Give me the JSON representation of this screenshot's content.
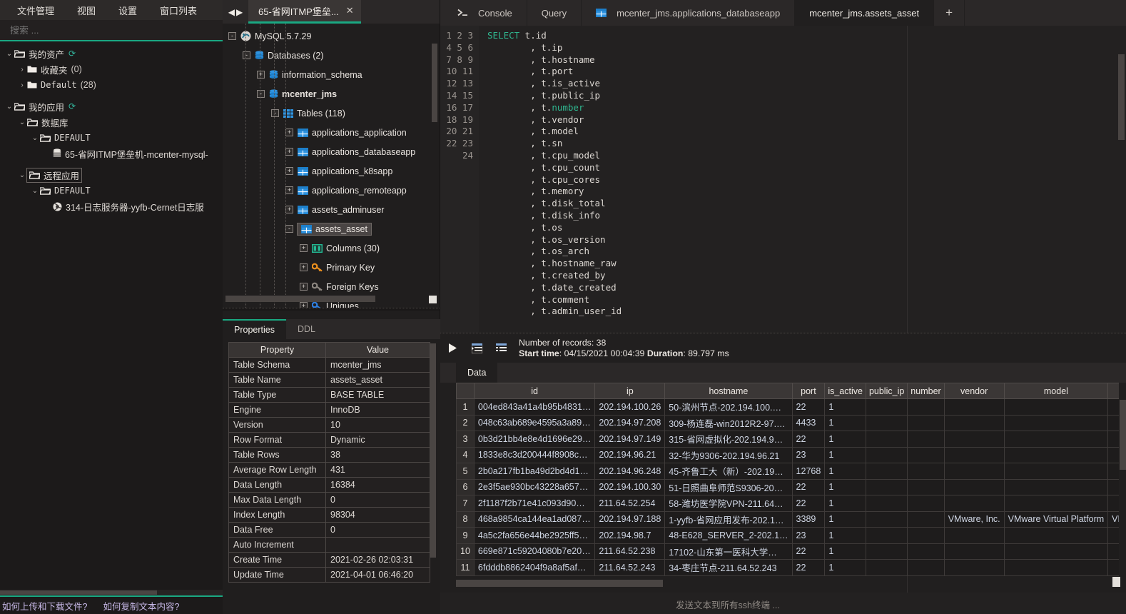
{
  "menubar": {
    "items": [
      "文件管理",
      "视图",
      "设置",
      "窗口列表"
    ]
  },
  "search": {
    "placeholder": "搜索 ..."
  },
  "asset_tree": {
    "items": [
      {
        "label": "我的资产",
        "indent": 0,
        "twisty": "down",
        "icon": "folder-open-icon",
        "count": "",
        "refresh": true,
        "mono": false,
        "selected": false
      },
      {
        "label": "收藏夹",
        "indent": 1,
        "twisty": "right",
        "icon": "folder-icon",
        "count": "(0)",
        "refresh": false,
        "mono": false,
        "selected": false
      },
      {
        "label": "Default",
        "indent": 1,
        "twisty": "right",
        "icon": "folder-icon",
        "count": "(28)",
        "refresh": false,
        "mono": true,
        "selected": false
      },
      {
        "label": "我的应用",
        "indent": 0,
        "twisty": "down",
        "icon": "folder-open-icon",
        "count": "",
        "refresh": true,
        "mono": false,
        "selected": false
      },
      {
        "label": "数据库",
        "indent": 1,
        "twisty": "down",
        "icon": "folder-open-icon",
        "count": "",
        "refresh": false,
        "mono": false,
        "selected": false
      },
      {
        "label": "DEFAULT",
        "indent": 2,
        "twisty": "down",
        "icon": "folder-open-icon",
        "count": "",
        "refresh": false,
        "mono": true,
        "selected": false
      },
      {
        "label": "65-省网ITMP堡垒机-mcenter-mysql-",
        "indent": 3,
        "twisty": "none",
        "icon": "database-icon",
        "count": "",
        "refresh": false,
        "mono": false,
        "selected": false
      },
      {
        "label": "远程应用",
        "indent": 1,
        "twisty": "down",
        "icon": "folder-open-icon",
        "count": "",
        "refresh": false,
        "mono": false,
        "selected": true
      },
      {
        "label": "DEFAULT",
        "indent": 2,
        "twisty": "down",
        "icon": "folder-open-icon",
        "count": "",
        "refresh": false,
        "mono": true,
        "selected": false
      },
      {
        "label": "314-日志服务器-yyfb-Cernet日志服",
        "indent": 3,
        "twisty": "none",
        "icon": "globe-icon",
        "count": "",
        "refresh": false,
        "mono": false,
        "selected": false
      }
    ]
  },
  "left_footer": {
    "links": [
      "如何上传和下载文件?",
      "如何复制文本内容?"
    ]
  },
  "session_tab": {
    "title": "65-省网ITMP堡垒...",
    "close": "✕"
  },
  "db_tree": {
    "items": [
      {
        "label": "MySQL 5.7.29",
        "indent": 0,
        "expander": "-",
        "icon": "mysql-icon",
        "bold": false,
        "selected": false
      },
      {
        "label": "Databases (2)",
        "indent": 1,
        "expander": "-",
        "icon": "db-stack-icon",
        "bold": false,
        "selected": false
      },
      {
        "label": "information_schema",
        "indent": 2,
        "expander": "+",
        "icon": "db-stack-icon",
        "bold": false,
        "selected": false
      },
      {
        "label": "mcenter_jms",
        "indent": 2,
        "expander": "-",
        "icon": "db-stack-icon",
        "bold": true,
        "selected": false
      },
      {
        "label": "Tables (118)",
        "indent": 3,
        "expander": "-",
        "icon": "tables-icon",
        "bold": false,
        "selected": false
      },
      {
        "label": "applications_application",
        "indent": 4,
        "expander": "+",
        "icon": "table-icon",
        "bold": false,
        "selected": false
      },
      {
        "label": "applications_databaseapp",
        "indent": 4,
        "expander": "+",
        "icon": "table-icon",
        "bold": false,
        "selected": false
      },
      {
        "label": "applications_k8sapp",
        "indent": 4,
        "expander": "+",
        "icon": "table-icon",
        "bold": false,
        "selected": false
      },
      {
        "label": "applications_remoteapp",
        "indent": 4,
        "expander": "+",
        "icon": "table-icon",
        "bold": false,
        "selected": false
      },
      {
        "label": "assets_adminuser",
        "indent": 4,
        "expander": "+",
        "icon": "table-icon",
        "bold": false,
        "selected": false
      },
      {
        "label": "assets_asset",
        "indent": 4,
        "expander": "-",
        "icon": "table-icon",
        "bold": false,
        "selected": true
      },
      {
        "label": "Columns (30)",
        "indent": 5,
        "expander": "+",
        "icon": "columns-icon",
        "bold": false,
        "selected": false
      },
      {
        "label": "Primary Key",
        "indent": 5,
        "expander": "+",
        "icon": "key-gold-icon",
        "bold": false,
        "selected": false
      },
      {
        "label": "Foreign Keys",
        "indent": 5,
        "expander": "+",
        "icon": "key-gray-icon",
        "bold": false,
        "selected": false
      },
      {
        "label": "Uniques",
        "indent": 5,
        "expander": "+",
        "icon": "key-blue-icon",
        "bold": false,
        "selected": false
      }
    ]
  },
  "properties_panel": {
    "tabs": [
      {
        "label": "Properties",
        "active": true
      },
      {
        "label": "DDL",
        "active": false
      }
    ],
    "headers": [
      "Property",
      "Value"
    ],
    "rows": [
      [
        "Table Schema",
        "mcenter_jms"
      ],
      [
        "Table Name",
        "assets_asset"
      ],
      [
        "Table Type",
        "BASE TABLE"
      ],
      [
        "Engine",
        "InnoDB"
      ],
      [
        "Version",
        "10"
      ],
      [
        "Row Format",
        "Dynamic"
      ],
      [
        "Table Rows",
        "38"
      ],
      [
        "Average Row Length",
        "431"
      ],
      [
        "Data Length",
        "16384"
      ],
      [
        "Max Data Length",
        "0"
      ],
      [
        "Index Length",
        "98304"
      ],
      [
        "Data Free",
        "0"
      ],
      [
        "Auto Increment",
        ""
      ],
      [
        "Create Time",
        "2021-02-26 02:03:31"
      ],
      [
        "Update Time",
        "2021-04-01 06:46:20"
      ]
    ]
  },
  "editor_tabs": [
    {
      "label": "Console",
      "icon": "console-icon",
      "active": false
    },
    {
      "label": "Query",
      "icon": "",
      "active": false
    },
    {
      "label": "mcenter_jms.applications_databaseapp",
      "icon": "table-icon",
      "active": false
    },
    {
      "label": "mcenter_jms.assets_asset",
      "icon": "",
      "active": true
    }
  ],
  "editor_add_tab": "+",
  "sql": {
    "keyword": "SELECT",
    "first_line_rest": " t.id",
    "lines": [
      ", t.ip",
      ", t.hostname",
      ", t.port",
      ", t.is_active",
      ", t.public_ip",
      ", t.number",
      ", t.vendor",
      ", t.model",
      ", t.sn",
      ", t.cpu_model",
      ", t.cpu_count",
      ", t.cpu_cores",
      ", t.memory",
      ", t.disk_total",
      ", t.disk_info",
      ", t.os",
      ", t.os_version",
      ", t.os_arch",
      ", t.hostname_raw",
      ", t.created_by",
      ", t.date_created",
      ", t.comment",
      ", t.admin_user_id"
    ]
  },
  "execution": {
    "play_icon": "play-icon",
    "fetch_icon": "fetch-next-page-icon",
    "list_icon": "fetch-all-rows-icon",
    "records_label": "Number of records: 38",
    "start_time_label": "Start time",
    "start_time_value": "04/15/2021 00:04:39",
    "duration_label": "Duration",
    "duration_value": "89.797 ms"
  },
  "result_tabs": [
    {
      "label": "Data",
      "active": true
    }
  ],
  "grid": {
    "columns": [
      "id",
      "ip",
      "hostname",
      "port",
      "is_active",
      "public_ip",
      "number",
      "vendor",
      "model",
      ""
    ],
    "rows": [
      {
        "n": "1",
        "cells": [
          "004ed843a41a4b95b4831…",
          "202.194.100.26",
          "50-滨州节点-202.194.100.…",
          "22",
          "1",
          "",
          "",
          "",
          "",
          ""
        ]
      },
      {
        "n": "2",
        "cells": [
          "048c63ab689e4595a3a89…",
          "202.194.97.208",
          "309-杨连磊-win2012R2-97.…",
          "4433",
          "1",
          "",
          "",
          "",
          "",
          ""
        ]
      },
      {
        "n": "3",
        "cells": [
          "0b3d21bb4e8e4d1696e29…",
          "202.194.97.149",
          "315-省网虚拟化-202.194.9…",
          "22",
          "1",
          "",
          "",
          "",
          "",
          ""
        ]
      },
      {
        "n": "4",
        "cells": [
          "1833e8c3d200444f8908c…",
          "202.194.96.21",
          "32-华为9306-202.194.96.21",
          "23",
          "1",
          "",
          "",
          "",
          "",
          ""
        ]
      },
      {
        "n": "5",
        "cells": [
          "2b0a217fb1ba49d2bd4d1…",
          "202.194.96.248",
          "45-齐鲁工大（新）-202.19…",
          "12768",
          "1",
          "",
          "",
          "",
          "",
          ""
        ]
      },
      {
        "n": "6",
        "cells": [
          "2e3f5ae930bc43228a657…",
          "202.194.100.30",
          "51-日照曲阜师范S9306-20…",
          "22",
          "1",
          "",
          "",
          "",
          "",
          ""
        ]
      },
      {
        "n": "7",
        "cells": [
          "2f1187f2b71e41c093d90…",
          "211.64.52.254",
          "58-潍坊医学院VPN-211.64…",
          "22",
          "1",
          "",
          "",
          "",
          "",
          ""
        ]
      },
      {
        "n": "8",
        "cells": [
          "468a9854ca144ea1ad087…",
          "202.194.97.188",
          "1-yyfb-省网应用发布-202.1…",
          "3389",
          "1",
          "",
          "",
          "VMware, Inc.",
          "VMware Virtual Platform",
          "VMware"
        ]
      },
      {
        "n": "9",
        "cells": [
          "4a5c2fa656e44be2925ff5…",
          "202.194.98.7",
          "48-E628_SERVER_2-202.1…",
          "23",
          "1",
          "",
          "",
          "",
          "",
          ""
        ]
      },
      {
        "n": "10",
        "cells": [
          "669e871c59204080b7e20…",
          "211.64.52.238",
          "17102-山东第一医科大学…",
          "22",
          "1",
          "",
          "",
          "",
          "",
          ""
        ]
      },
      {
        "n": "11",
        "cells": [
          "6fdddb8862404f9a8af5af…",
          "211.64.52.243",
          "34-枣庄节点-211.64.52.243",
          "22",
          "1",
          "",
          "",
          "",
          "",
          ""
        ]
      }
    ]
  },
  "bottom": {
    "ssh_placeholder": "发送文本到所有ssh终端 ..."
  },
  "colors": {
    "accent": "#1aa882",
    "link": "#c8b9e8",
    "keyword": "#2fb68f",
    "cell_text": "#cfd6e4"
  }
}
